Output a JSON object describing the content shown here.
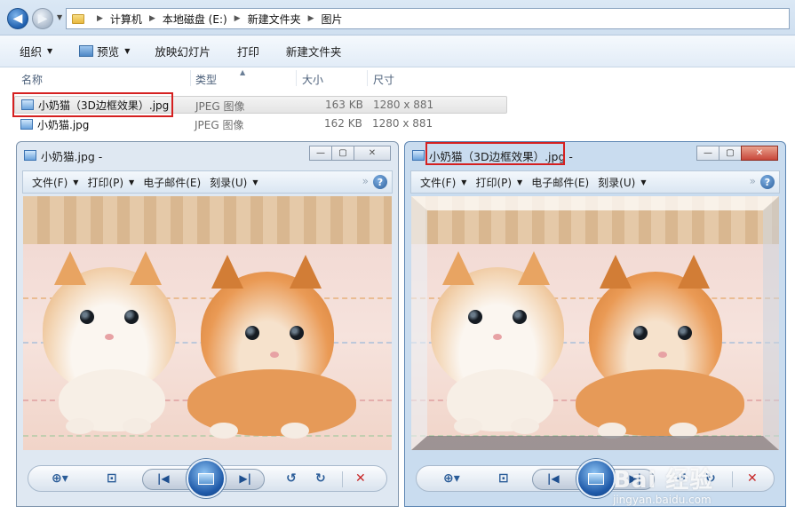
{
  "explorer": {
    "breadcrumbs": [
      "计算机",
      "本地磁盘 (E:)",
      "新建文件夹",
      "图片"
    ],
    "toolbar": {
      "organize": "组织",
      "preview": "预览",
      "slideshow": "放映幻灯片",
      "print": "打印",
      "new_folder": "新建文件夹"
    },
    "columns": {
      "name": "名称",
      "type": "类型",
      "size": "大小",
      "dimensions": "尺寸"
    },
    "files": [
      {
        "name": "小奶猫（3D边框效果）.jpg",
        "type": "JPEG 图像",
        "size": "163 KB",
        "dimensions": "1280 x 881",
        "selected": true
      },
      {
        "name": "小奶猫.jpg",
        "type": "JPEG 图像",
        "size": "162 KB",
        "dimensions": "1280 x 881",
        "selected": false
      }
    ]
  },
  "viewer_left": {
    "title": "小奶猫.jpg -",
    "menu": {
      "file": "文件(F)",
      "print": "打印(P)",
      "email": "电子邮件(E)",
      "burn": "刻录(U)"
    }
  },
  "viewer_right": {
    "title": "小奶猫（3D边框效果）.jpg -",
    "menu": {
      "file": "文件(F)",
      "print": "打印(P)",
      "email": "电子邮件(E)",
      "burn": "刻录(U)"
    }
  },
  "icons": {
    "back": "back-arrow-icon",
    "forward": "forward-arrow-icon",
    "zoom": "zoom-icon",
    "fit": "actual-size-icon",
    "prev": "previous-icon",
    "next": "next-icon",
    "rotate_ccw": "rotate-counterclockwise-icon",
    "rotate_cw": "rotate-clockwise-icon",
    "delete": "delete-icon",
    "help": "help-icon"
  },
  "colors": {
    "highlight_box": "#d52020",
    "accent": "#1f5aa9"
  },
  "watermark": {
    "main": "Bai 经验",
    "sub": "jingyan.baidu.com"
  }
}
